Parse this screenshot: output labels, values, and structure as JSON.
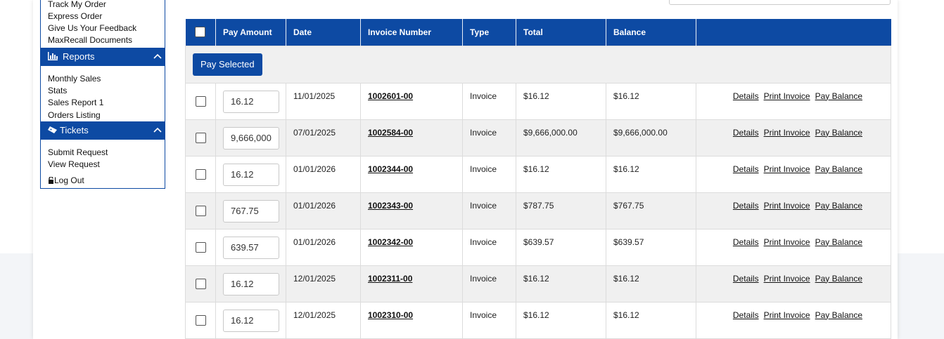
{
  "sidebar": {
    "links_top": [
      "Track My Order",
      "Express Order",
      "Give Us Your Feedback",
      "MaxRecall Documents"
    ],
    "reports": {
      "title": "Reports",
      "items": [
        "Monthly Sales",
        "Stats",
        "Sales Report 1",
        "Orders Listing"
      ]
    },
    "tickets": {
      "title": "Tickets",
      "items": [
        "Submit Request",
        "View Request"
      ]
    },
    "logout": "Log Out"
  },
  "table": {
    "headers": [
      "Pay Amount",
      "Date",
      "Invoice Number",
      "Type",
      "Total",
      "Balance"
    ],
    "pay_selected": "Pay Selected",
    "actions": [
      "Details",
      "Print Invoice",
      "Pay Balance"
    ],
    "rows": [
      {
        "pay": "16.12",
        "date": "11/01/2025",
        "invoice": "1002601-00",
        "type": "Invoice",
        "total": "$16.12",
        "balance": "$16.12"
      },
      {
        "pay": "9,666,000",
        "date": "07/01/2025",
        "invoice": "1002584-00",
        "type": "Invoice",
        "total": "$9,666,000.00",
        "balance": "$9,666,000.00"
      },
      {
        "pay": "16.12",
        "date": "01/01/2026",
        "invoice": "1002344-00",
        "type": "Invoice",
        "total": "$16.12",
        "balance": "$16.12"
      },
      {
        "pay": "767.75",
        "date": "01/01/2026",
        "invoice": "1002343-00",
        "type": "Invoice",
        "total": "$787.75",
        "balance": "$767.75"
      },
      {
        "pay": "639.57",
        "date": "01/01/2026",
        "invoice": "1002342-00",
        "type": "Invoice",
        "total": "$639.57",
        "balance": "$639.57"
      },
      {
        "pay": "16.12",
        "date": "12/01/2025",
        "invoice": "1002311-00",
        "type": "Invoice",
        "total": "$16.12",
        "balance": "$16.12"
      },
      {
        "pay": "16.12",
        "date": "12/01/2025",
        "invoice": "1002310-00",
        "type": "Invoice",
        "total": "$16.12",
        "balance": "$16.12"
      }
    ]
  },
  "colors": {
    "primary": "#0d4aa3",
    "row_alt": "#f0f0f0"
  }
}
